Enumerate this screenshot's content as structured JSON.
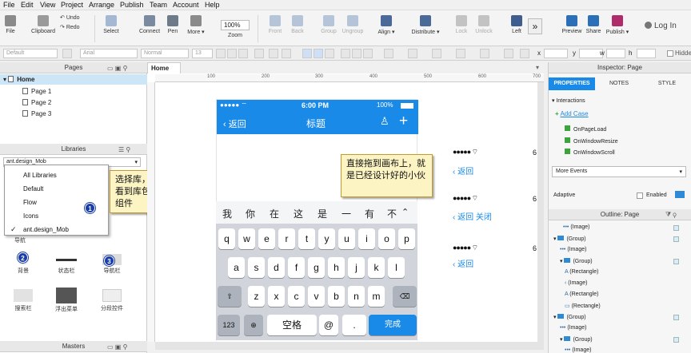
{
  "menu": [
    "File",
    "Edit",
    "View",
    "Project",
    "Arrange",
    "Publish",
    "Team",
    "Account",
    "Help"
  ],
  "toolbar": {
    "file": "File",
    "clipboard": "Clipboard",
    "undo": "Undo",
    "redo": "Redo",
    "select": "Select",
    "connect": "Connect",
    "pen": "Pen",
    "more": "More",
    "zoom_value": "100%",
    "zoom": "Zoom",
    "front": "Front",
    "back": "Back",
    "group": "Group",
    "ungroup": "Ungroup",
    "align": "Align",
    "distribute": "Distribute",
    "lock": "Lock",
    "unlock": "Unlock",
    "left": "Left",
    "preview": "Preview",
    "share": "Share",
    "publish": "Publish",
    "login": "Log In"
  },
  "format": {
    "style": "Default",
    "font": "Arial",
    "weight": "Normal",
    "size": "13",
    "x": "x",
    "y": "y",
    "w": "w",
    "h": "h",
    "hidden": "Hidden"
  },
  "pages": {
    "title": "Pages",
    "home": "Home",
    "items": [
      "Page 1",
      "Page 2",
      "Page 3"
    ]
  },
  "libraries": {
    "title": "Libraries",
    "selected": "ant.design_Mob",
    "group_label": "导航",
    "dropdown": [
      "All Libraries",
      "Default",
      "Flow",
      "Icons",
      "ant.design_Mob"
    ],
    "icons": [
      "背景",
      "状态栏",
      "导航栏",
      "搜索栏",
      "浮出菜单",
      "分段控件"
    ]
  },
  "masters": {
    "title": "Masters"
  },
  "canvas_tab": "Home",
  "ruler": [
    "100",
    "200",
    "300",
    "400",
    "500",
    "600",
    "700"
  ],
  "phone": {
    "signal": "●●●●● ⌔",
    "time": "6:00 PM",
    "battery": "100%",
    "back": "返回",
    "title": "标题"
  },
  "candidates": [
    "我",
    "你",
    "在",
    "这",
    "是",
    "一",
    "有",
    "不"
  ],
  "keyboard": {
    "row1": [
      "q",
      "w",
      "e",
      "r",
      "t",
      "y",
      "u",
      "i",
      "o",
      "p"
    ],
    "row2": [
      "a",
      "s",
      "d",
      "f",
      "g",
      "h",
      "j",
      "k",
      "l"
    ],
    "row3": [
      "z",
      "x",
      "c",
      "v",
      "b",
      "n",
      "m"
    ],
    "num": "123",
    "space": "空格",
    "at": "@",
    "dot": ".",
    "done": "完成"
  },
  "notes": {
    "library": "选择库，就会看到库包含的组件",
    "drag": "直接拖到画布上，就是已经设计好的小伙"
  },
  "side_components": [
    {
      "dots": "●●●●● ⌔",
      "six": "6",
      "back": "返回",
      "extra": ""
    },
    {
      "dots": "●●●●● ⌔",
      "six": "6",
      "back": "返回",
      "extra": "关闭"
    },
    {
      "dots": "●●●●● ⌔",
      "six": "6",
      "back": "返回",
      "extra": ""
    }
  ],
  "badges": {
    "one": "1",
    "two": "2",
    "three": "3"
  },
  "inspector": {
    "title": "Inspector: Page",
    "tabs": [
      "PROPERTIES",
      "NOTES",
      "STYLE"
    ],
    "interactions": "Interactions",
    "add_case": "Add Case",
    "events": [
      "OnPageLoad",
      "OnWindowResize",
      "OnWindowScroll"
    ],
    "more_events": "More Events",
    "adaptive": "Adaptive",
    "enabled": "Enabled"
  },
  "outline": {
    "title": "Outline: Page",
    "rows": [
      "(Image)",
      "(Group)",
      "(Image)",
      "(Group)",
      "(Rectangle)",
      "(Image)",
      "(Rectangle)",
      "(Rectangle)",
      "(Group)",
      "(Image)",
      "(Group)",
      "(Image)"
    ]
  },
  "colors": {
    "accent": "#1a8ae8",
    "note_bg": "#fdf4c4",
    "badge": "#1a3ea8"
  }
}
